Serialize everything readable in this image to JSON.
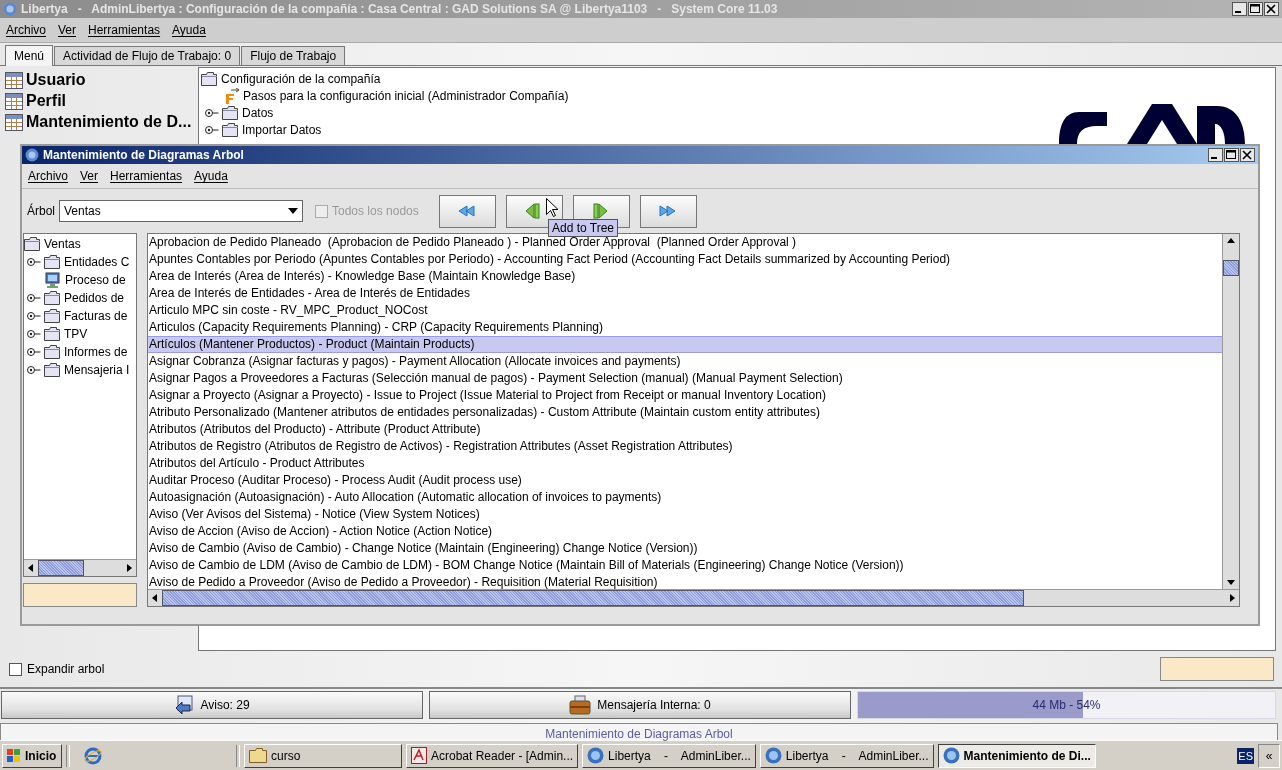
{
  "window": {
    "title": "Libertya   -   AdminLibertya : Configuración de la compañía : Casa Central : GAD Solutions SA @ Libertya1103   -   System Core 11.03"
  },
  "menu": [
    "Archivo",
    "Ver",
    "Herramientas",
    "Ayuda"
  ],
  "tabs": [
    {
      "label": "Menú",
      "selected": true
    },
    {
      "label": "Actividad de Flujo de Trabajo: 0",
      "selected": false
    },
    {
      "label": "Flujo de Trabajo",
      "selected": false
    }
  ],
  "favorites": [
    "Usuario",
    "Perfil",
    "Mantenimiento de D..."
  ],
  "menu_tree": {
    "label": "Configuración de la compañía",
    "children": [
      {
        "label": "Pasos para la configuración inicial (Administrador Compañía)",
        "kind": "workflow"
      },
      {
        "label": "Datos",
        "kind": "folder"
      },
      {
        "label": "Importar Datos",
        "kind": "folder"
      }
    ]
  },
  "expand_tree": {
    "label": "Expandir arbol",
    "checked": false
  },
  "status_buttons": [
    {
      "label": "Aviso: 29",
      "kind": "notice"
    },
    {
      "label": "Mensajería Interna: 0",
      "kind": "mail"
    }
  ],
  "memory": {
    "label": "44 Mb - 54%",
    "level": 0.54
  },
  "status_line": "Mantenimiento de Diagramas Arbol",
  "dialog": {
    "title": "Mantenimiento de Diagramas Arbol",
    "menu": [
      "Archivo",
      "Ver",
      "Herramientas",
      "Ayuda"
    ],
    "tree_label": "Árbol",
    "tree_value": "Ventas",
    "all_nodes": {
      "label": "Todos los nodos",
      "checked": false,
      "disabled": true
    },
    "buttons": [
      {
        "kind": "remove_all"
      },
      {
        "kind": "remove"
      },
      {
        "kind": "add"
      },
      {
        "kind": "add_all"
      }
    ],
    "tooltip": "Add to Tree",
    "tree": {
      "label": "Ventas",
      "children": [
        {
          "label": "Entidades C",
          "kind": "folder"
        },
        {
          "label": "Proceso de",
          "kind": "process"
        },
        {
          "label": "Pedidos de",
          "kind": "folder"
        },
        {
          "label": "Facturas de",
          "kind": "folder"
        },
        {
          "label": "TPV",
          "kind": "folder"
        },
        {
          "label": "Informes de",
          "kind": "folder"
        },
        {
          "label": "Mensajeria I",
          "kind": "folder"
        }
      ]
    },
    "items": [
      {
        "label": "Aprobacion de Pedido Planeado  (Aprobacion de Pedido Planeado ) - Planned Order Approval  (Planned Order Approval )",
        "selected": false
      },
      {
        "label": "Apuntes Contables por Periodo (Apuntes Contables por Periodo) - Accounting Fact Period (Accounting Fact Details summarized by Accounting Period)",
        "selected": false
      },
      {
        "label": "Area de Interés (Area de Interés) - Knowledge Base (Maintain Knowledge Base)",
        "selected": false
      },
      {
        "label": "Area de Interés de Entidades - Area de Interés de Entidades",
        "selected": false
      },
      {
        "label": "Articulo MPC sin coste - RV_MPC_Product_NOCost",
        "selected": false
      },
      {
        "label": "Articulos (Capacity Requirements Planning) - CRP (Capacity Requirements Planning)",
        "selected": false
      },
      {
        "label": "Artículos (Mantener Productos) - Product (Maintain Products)",
        "selected": true
      },
      {
        "label": "Asignar Cobranza (Asignar facturas y pagos) - Payment Allocation (Allocate invoices and payments)",
        "selected": false
      },
      {
        "label": "Asignar Pagos a Proveedores a Facturas (Selección manual de pagos) - Payment Selection (manual) (Manual Payment Selection)",
        "selected": false
      },
      {
        "label": "Asignar a Proyecto (Asignar a Proyecto) - Issue to Project (Issue Material to Project from Receipt or manual Inventory Location)",
        "selected": false
      },
      {
        "label": "Atributo Personalizado (Mantener atributos de entidades personalizadas) - Custom Attribute (Maintain custom entity attributes)",
        "selected": false
      },
      {
        "label": "Atributos (Atributos del Producto) - Attribute (Product Attribute)",
        "selected": false
      },
      {
        "label": "Atributos de Registro (Atributos de Registro de Activos) - Registration Attributes (Asset Registration Attributes)",
        "selected": false
      },
      {
        "label": "Atributos del Artículo - Product Attributes",
        "selected": false
      },
      {
        "label": "Auditar Proceso (Auditar Proceso) - Process Audit (Audit process use)",
        "selected": false
      },
      {
        "label": "Autoasignación (Autoasignación) - Auto Allocation (Automatic allocation of invoices to payments)",
        "selected": false
      },
      {
        "label": "Aviso (Ver Avisos del Sistema) - Notice (View System Notices)",
        "selected": false
      },
      {
        "label": "Aviso de Accion (Aviso de Accion) - Action Notice (Action Notice)",
        "selected": false
      },
      {
        "label": "Aviso de Cambio (Aviso de Cambio) - Change Notice (Maintain (Engineering) Change Notice (Version))",
        "selected": false
      },
      {
        "label": "Aviso de Cambio de LDM (Aviso de Cambio de LDM) - BOM Change Notice (Maintain Bill of Materials (Engineering) Change Notice (Version))",
        "selected": false
      },
      {
        "label": "Aviso de Pedido a Proveedor (Aviso de Pedido a Proveedor) - Requisition (Material Requisition)",
        "selected": false
      }
    ]
  },
  "taskbar": {
    "start": "Inicio",
    "tasks": [
      {
        "label": "curso",
        "kind": "folder",
        "selected": false
      },
      {
        "label": "Acrobat Reader - [Admin...",
        "kind": "pdf",
        "selected": false
      },
      {
        "label": "Libertya    -    AdminLiber...",
        "kind": "app",
        "selected": false
      },
      {
        "label": "Libertya    -    AdminLiber...",
        "kind": "app",
        "selected": false
      },
      {
        "label": "Mantenimiento de Di...",
        "kind": "app",
        "selected": true
      }
    ],
    "language": "ES",
    "collapse": "«"
  }
}
